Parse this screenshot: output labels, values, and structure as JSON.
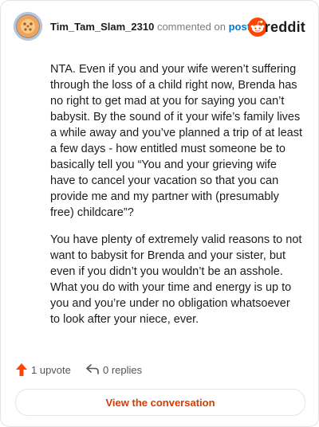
{
  "header": {
    "username": "Tim_Tam_Slam_2310",
    "commented_text": "commented on",
    "post_link": "post",
    "brand_name": "reddit",
    "brand_color": "#ff4500"
  },
  "comment": {
    "paragraphs": [
      "NTA. Even if you and your wife weren’t suffering through the loss of a child right now, Brenda has no right to get mad at you for saying you can’t babysit. By the sound of it your wife’s family lives a while away and you’ve planned a trip of at least a few days - how entitled must someone be to basically tell you “You and your grieving wife have to cancel your vacation so that you can provide me and my partner with (presumably free) childcare”?",
      "You have plenty of extremely valid reasons to not want to babysit for Brenda and your sister, but even if you didn’t you wouldn’t be an asshole. What you do with your time and energy is up to you and you’re under no obligation whatsoever to look after your niece, ever."
    ]
  },
  "footer": {
    "upvotes": "1 upvote",
    "replies": "0 replies",
    "upvote_icon": "upvote-arrow-icon",
    "reply_icon": "reply-arrow-icon"
  },
  "cta": {
    "label": "View the conversation",
    "color": "#d93a00"
  }
}
